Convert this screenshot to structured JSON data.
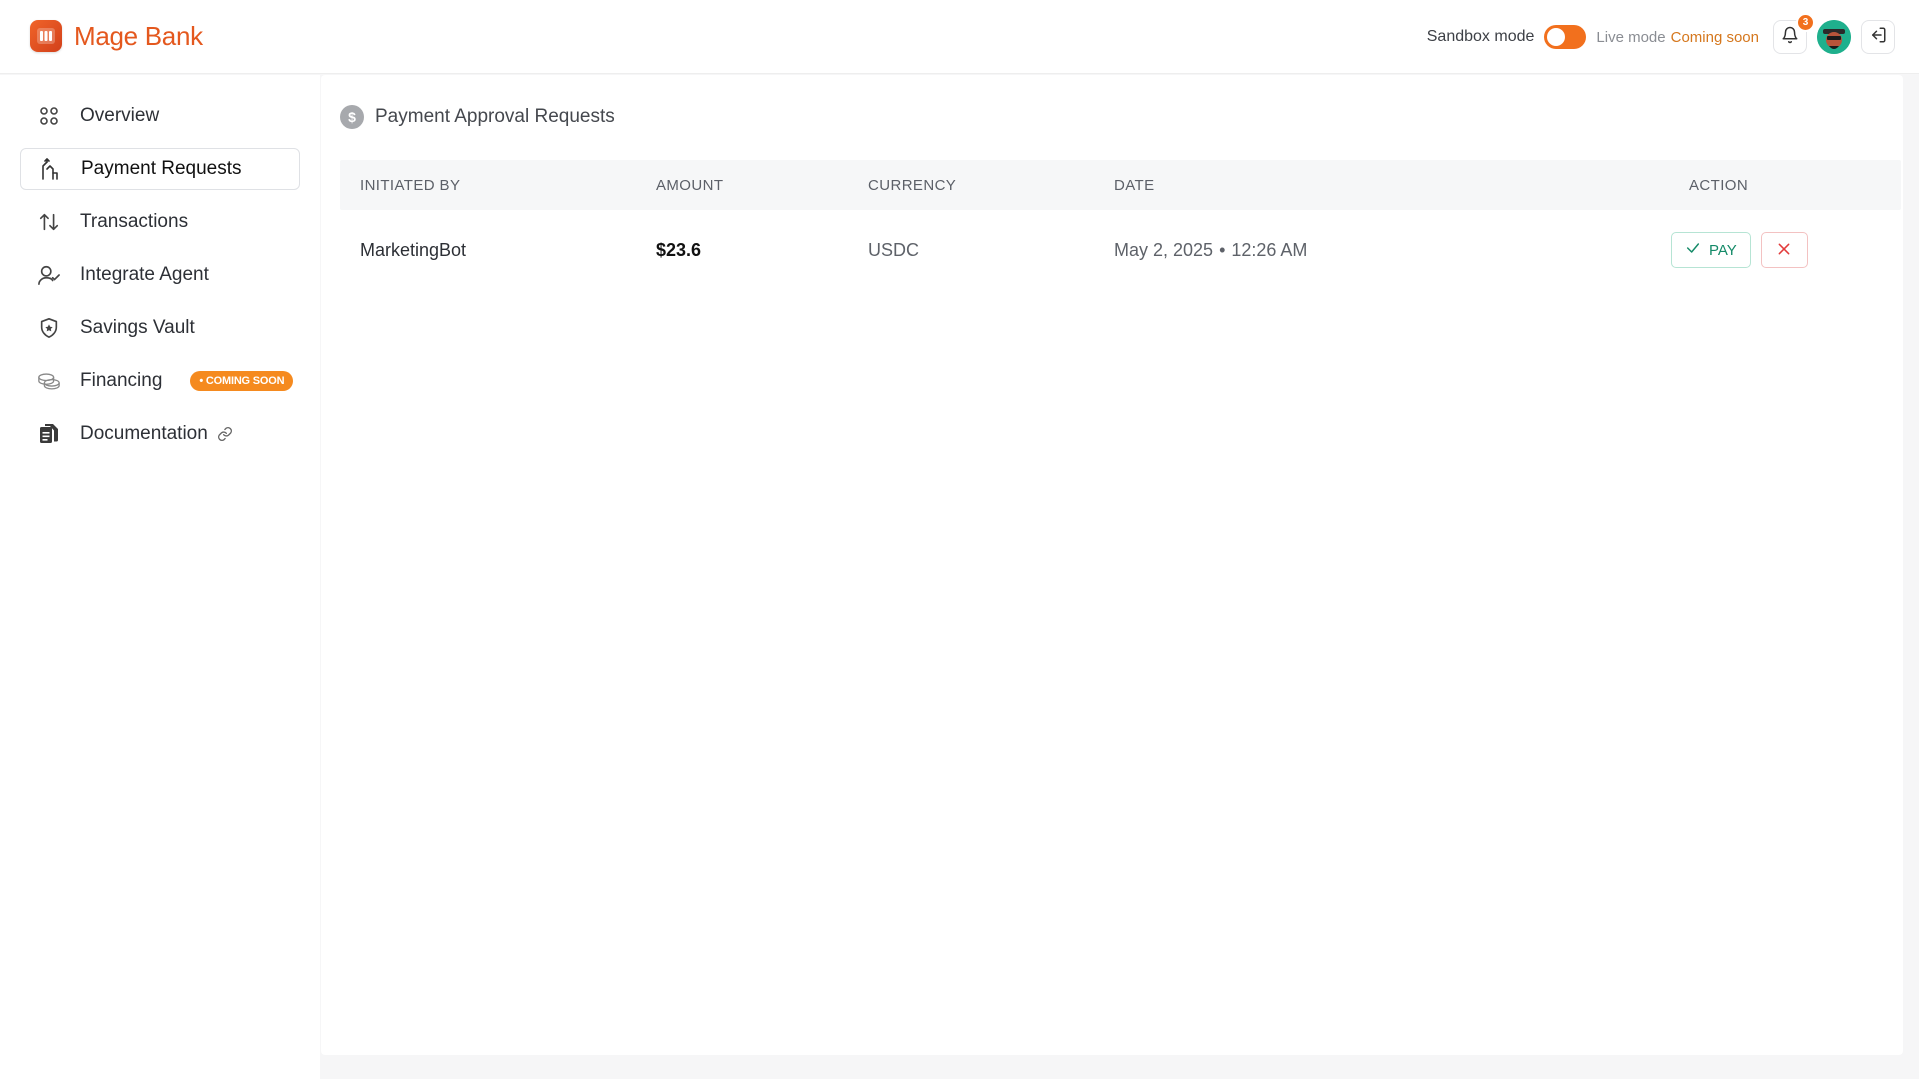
{
  "brand": {
    "name": "Mage Bank",
    "accent": "#f2701d"
  },
  "header": {
    "sandbox_label": "Sandbox mode",
    "live_label": "Live mode",
    "live_status": "Coming soon",
    "notification_count": "3"
  },
  "sidebar": {
    "items": [
      {
        "label": "Overview",
        "icon": "grid-icon"
      },
      {
        "label": "Payment Requests",
        "icon": "hand-pay-icon",
        "active": true
      },
      {
        "label": "Transactions",
        "icon": "arrows-up-down-icon"
      },
      {
        "label": "Integrate Agent",
        "icon": "user-check-icon"
      },
      {
        "label": "Savings Vault",
        "icon": "shield-star-icon"
      },
      {
        "label": "Financing",
        "icon": "coins-icon",
        "badge": "• COMING SOON"
      },
      {
        "label": "Documentation",
        "icon": "documents-icon",
        "link_icon": "link-icon"
      }
    ]
  },
  "main": {
    "title": "Payment Approval Requests",
    "table": {
      "headers": [
        "INITIATED BY",
        "AMOUNT",
        "CURRENCY",
        "DATE",
        "ACTION"
      ],
      "rows": [
        {
          "initiated_by": "MarketingBot",
          "amount": "$23.6",
          "currency": "USDC",
          "date": "May 2, 2025",
          "time": "12:26 AM",
          "pay_label": "PAY"
        }
      ]
    }
  }
}
